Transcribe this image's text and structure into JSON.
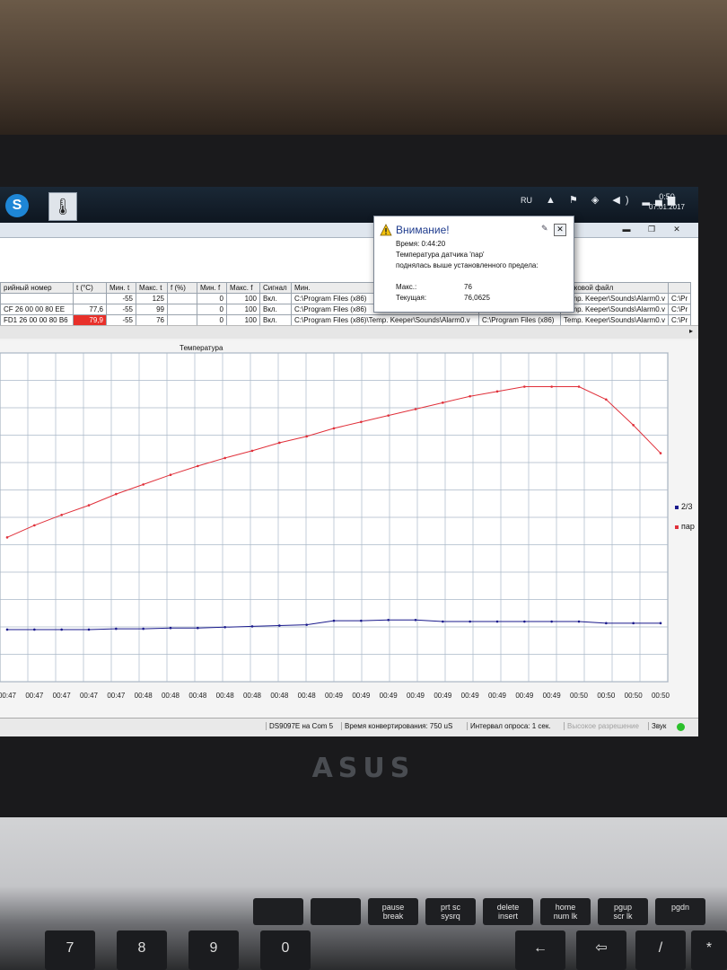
{
  "taskbar": {
    "skype_letter": "S",
    "app_icon": "thermometer-app-icon",
    "lang": "RU",
    "time": "0:50",
    "date": "07.01.2017",
    "tray_icons": [
      "network-icon",
      "flag-icon",
      "volume-icon",
      "signal-icon"
    ]
  },
  "window": {
    "minimize": "▬",
    "restore": "❐",
    "close": "✕"
  },
  "table": {
    "headers": [
      "рийный номер",
      "t (°C)",
      "Мин. t",
      "Макс. t",
      "f (%)",
      "Мин. f",
      "Макс. f",
      "Сигнал",
      "Мин.",
      "",
      "звуковой файл",
      ""
    ],
    "rows": [
      [
        "",
        "",
        "-55",
        "125",
        "",
        "0",
        "100",
        "Вкл.",
        "C:\\Program Files (x86)",
        "",
        "Temp. Keeper\\Sounds\\Alarm0.v",
        "C:\\Pr"
      ],
      [
        "CF 26 00 00 80 EE",
        "77,6",
        "-55",
        "99",
        "",
        "0",
        "100",
        "Вкл.",
        "C:\\Program Files (x86)",
        "",
        "Temp. Keeper\\Sounds\\Alarm0.v",
        "C:\\Pr"
      ],
      [
        "FD1 26 00 00 80 B6",
        "79,9",
        "-55",
        "76",
        "",
        "0",
        "100",
        "Вкл.",
        "C:\\Program Files (x86)\\Temp. Keeper\\Sounds\\Alarm0.v",
        "C:\\Program Files (x86)",
        "Temp. Keeper\\Sounds\\Alarm0.v",
        "C:\\Pr"
      ]
    ]
  },
  "popup": {
    "title": "Внимание!",
    "time_line": "Время: 0:44:20",
    "line1": "Температура датчика 'пар'",
    "line2": "поднялась выше установленного предела:",
    "max_label": "Макс.:",
    "max_value": "76",
    "current_label": "Текущая:",
    "current_value": "76,0625"
  },
  "chart_data": {
    "type": "line",
    "title": "Температура",
    "categories": [
      "00:47",
      "00:47",
      "00:47",
      "00:47",
      "00:47",
      "00:48",
      "00:48",
      "00:48",
      "00:48",
      "00:48",
      "00:48",
      "00:48",
      "00:49",
      "00:49",
      "00:49",
      "00:49",
      "00:49",
      "00:49",
      "00:49",
      "00:49",
      "00:49",
      "00:50",
      "00:50",
      "00:50",
      "00:50"
    ],
    "series": [
      {
        "name": "2/3",
        "color": "#1a1a8c",
        "values": [
          51.5,
          51.5,
          51.5,
          51.5,
          51.6,
          51.6,
          51.7,
          51.7,
          51.8,
          51.9,
          52.0,
          52.1,
          52.6,
          52.6,
          52.7,
          52.7,
          52.5,
          52.5,
          52.5,
          52.5,
          52.5,
          52.5,
          52.3,
          52.3,
          52.3
        ]
      },
      {
        "name": "пар",
        "color": "#e0303a",
        "values": [
          63.0,
          64.5,
          65.8,
          67.0,
          68.4,
          69.6,
          70.8,
          71.9,
          72.9,
          73.8,
          74.8,
          75.6,
          76.6,
          77.4,
          78.2,
          79.0,
          79.8,
          80.6,
          81.2,
          81.8,
          81.8,
          81.8,
          80.2,
          77.0,
          73.5
        ]
      }
    ],
    "grid": true,
    "legend": "right"
  },
  "statusbar": {
    "port": "DS9097E на Com 5",
    "conversion": "Время конвертирования: 750 uS",
    "interval": "Интервал опроса: 1 сек.",
    "hires": "Высокое разрешение",
    "sound": "Звук"
  },
  "laptop": {
    "brand": "ASUS",
    "fkeys": [
      {
        "top": "",
        "bottom": ""
      },
      {
        "top": "",
        "bottom": ""
      },
      {
        "top": "pause",
        "bottom": "break"
      },
      {
        "top": "prt sc",
        "bottom": "sysrq"
      },
      {
        "top": "delete",
        "bottom": "insert"
      },
      {
        "top": "home",
        "bottom": "num lk"
      },
      {
        "top": "pgup",
        "bottom": "scr lk"
      },
      {
        "top": "pgdn",
        "bottom": ""
      }
    ],
    "numkeys": [
      "7",
      "8",
      "9",
      "0",
      "←",
      "⇦",
      "/",
      "*"
    ]
  }
}
